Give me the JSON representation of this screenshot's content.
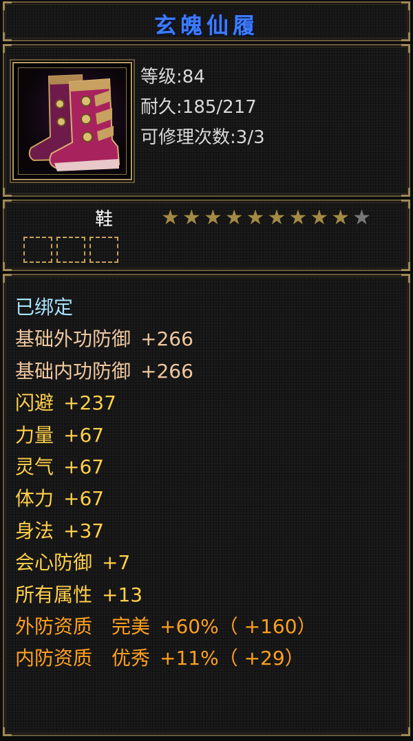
{
  "item_name": "玄魄仙履",
  "level_label": "等级",
  "level_value": "84",
  "durability_label": "耐久",
  "durability_value": "185/217",
  "repair_label": "可修理次数",
  "repair_value": "3/3",
  "item_type": "鞋",
  "stars": {
    "filled": 9,
    "total": 10
  },
  "gem_slots": 3,
  "bound": "已绑定",
  "attributes": [
    {
      "name": "基础外功防御",
      "value": "+266",
      "color": "#f0c8a0"
    },
    {
      "name": "基础内功防御",
      "value": "+266",
      "color": "#f0c8a0"
    },
    {
      "name": "闪避",
      "value": "+237",
      "color": "#ffd04a"
    },
    {
      "name": "力量",
      "value": "+67",
      "color": "#ffd04a"
    },
    {
      "name": "灵气",
      "value": "+67",
      "color": "#ffd04a"
    },
    {
      "name": "体力",
      "value": "+67",
      "color": "#ffd04a"
    },
    {
      "name": "身法",
      "value": "+37",
      "color": "#ffd04a"
    },
    {
      "name": "会心防御",
      "value": "+7",
      "color": "#ffd04a"
    },
    {
      "name": "所有属性",
      "value": "+13",
      "color": "#ffd04a"
    }
  ],
  "qualities": [
    {
      "name": "外防资质",
      "grade": "完美",
      "value": "+60%",
      "extra": "（ +160）",
      "color": "#ffa020"
    },
    {
      "name": "内防资质",
      "grade": "优秀",
      "value": "+11%",
      "extra": "（ +29）",
      "color": "#ffa020"
    }
  ],
  "colors": {
    "title": "#3d7cff",
    "bound": "#a8e4ff",
    "frame": "#6b5a3a"
  }
}
